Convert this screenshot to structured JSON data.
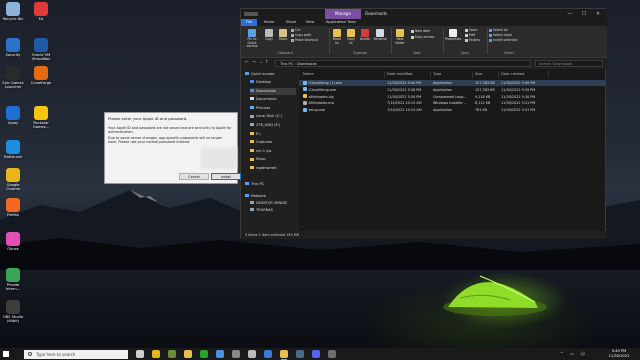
{
  "desktop": {
    "icons": [
      {
        "label": "Recycle Bin",
        "icon": "recycle-bin-icon",
        "color": "#8fb3d8"
      },
      {
        "label": "EA",
        "icon": "ea-icon",
        "color": "#e03a3a"
      },
      {
        "label": "Security",
        "icon": "shield-icon",
        "color": "#2a73c8"
      },
      {
        "label": "Oracle VM VirtualBox",
        "icon": "virtualbox-icon",
        "color": "#1e5aa8"
      },
      {
        "label": "Epic Games Launcher",
        "icon": "epic-games-icon",
        "color": "#2b2b2b"
      },
      {
        "label": "CurseForge",
        "icon": "curseforge-icon",
        "color": "#e4690f"
      },
      {
        "label": "Uplay",
        "icon": "uplay-icon",
        "color": "#1f6ed4"
      },
      {
        "label": "Rockstar Games...",
        "icon": "rockstar-icon",
        "color": "#f4c40f"
      },
      {
        "label": "Battle.net",
        "icon": "battlenet-icon",
        "color": "#1c8ee0"
      },
      {
        "label": "Google Chrome",
        "icon": "chrome-icon",
        "color": "#e9b61c"
      },
      {
        "label": "Firefox",
        "icon": "firefox-icon",
        "color": "#f26a21"
      },
      {
        "label": "iTunes",
        "icon": "itunes-icon",
        "color": "#e24fb4"
      },
      {
        "label": "Private Intern...",
        "icon": "vpn-icon",
        "color": "#3aa655"
      },
      {
        "label": "OBS Studio (64bit)",
        "icon": "obs-icon",
        "color": "#3d3d3d"
      }
    ]
  },
  "explorer": {
    "manage_tab": "Manage",
    "window_title": "Downloads",
    "window_controls": {
      "minimize": "—",
      "maximize": "☐",
      "close": "✕"
    },
    "tabs": [
      "File",
      "Home",
      "Share",
      "View",
      "Application Tools"
    ],
    "ribbon": {
      "pin": "Pin to Quick access",
      "copy": "Copy",
      "paste": "Paste",
      "cut": "Cut",
      "copy_path": "Copy path",
      "paste_shortcut": "Paste shortcut",
      "move_to": "Move to",
      "copy_to": "Copy to",
      "delete": "Delete",
      "rename": "Rename",
      "new_folder": "New folder",
      "new_item": "New item",
      "easy_access": "Easy access",
      "properties": "Properties",
      "open": "Open",
      "edit": "Edit",
      "history": "History",
      "select_all": "Select all",
      "select_none": "Select none",
      "invert_selection": "Invert selection",
      "groups": [
        "Clipboard",
        "Organize",
        "New",
        "Open",
        "Select"
      ]
    },
    "address": {
      "path": "This PC  ›  Downloads",
      "search_placeholder": "Search Downloads"
    },
    "nav": {
      "quick_access": "Quick access",
      "items": [
        {
          "label": "Desktop",
          "color": "#4a90e2"
        },
        {
          "label": "Downloads",
          "color": "#4a90e2"
        },
        {
          "label": "Documents",
          "color": "#cfd8e3"
        },
        {
          "label": "Pictures",
          "color": "#5fb0e8"
        },
        {
          "label": "Local Disk (C:)",
          "color": "#9aa6b2"
        },
        {
          "label": "2TB_HDD (E:)",
          "color": "#9aa6b2"
        },
        {
          "label": "E:\\",
          "color": "#e8c050"
        },
        {
          "label": "Captures",
          "color": "#e8c050"
        },
        {
          "label": "vm 1 ips",
          "color": "#e8c050"
        },
        {
          "label": "Music",
          "color": "#e8c050"
        },
        {
          "label": "rqpbnwired",
          "color": "#e8c050"
        }
      ],
      "this_pc": "This PC",
      "network": "Network",
      "network_items": [
        "DESKTOP-VRNDIE",
        "TRUENAS"
      ]
    },
    "columns": [
      "Name",
      "Date modified",
      "Type",
      "Size",
      "Date created"
    ],
    "files": [
      {
        "name": "iCloudSetup (1).exe",
        "modified": "11/30/2022 5:40 PM",
        "type": "Application",
        "size": "157,383 KB",
        "created": "11/30/2022 5:40 PM",
        "icon_color": "#7fb7f0",
        "selected": true
      },
      {
        "name": "iCloudSetup.exe",
        "modified": "11/30/2022 5:38 PM",
        "type": "Application",
        "size": "157,383 KB",
        "created": "11/30/2022 5:39 PM",
        "icon_color": "#7fb7f0",
        "selected": false
      },
      {
        "name": "alltrinkadm.zip",
        "modified": "11/30/2022 5:30 PM",
        "type": "Compressed (zipp...",
        "size": "9,118 KB",
        "created": "11/30/2022 5:30 PM",
        "icon_color": "#e8c050",
        "selected": false
      },
      {
        "name": "AMinstaller.msi",
        "modified": "7/14/2022 10:15 AM",
        "type": "Windows Installer ...",
        "size": "8,112 KB",
        "created": "11/30/2022 5:31 PM",
        "icon_color": "#b0b0b0",
        "selected": false
      },
      {
        "name": "setup.exe",
        "modified": "7/14/2022 10:14 AM",
        "type": "Application",
        "size": "781 KB",
        "created": "11/30/2022 5:31 PM",
        "icon_color": "#7fb7f0",
        "selected": false
      }
    ],
    "status": "5 items    1 item selected  153 MB"
  },
  "dialog": {
    "title": "Please enter your Apple ID and password.",
    "body": "Your Apple ID and password are not saved and are sent only to Apple for authentication.",
    "body2": "Due to some server changes, app-specific passwords will no longer work. Please use your normal password instead.",
    "cancel": "Cancel",
    "install": "Install"
  },
  "taskbar": {
    "search_placeholder": "Type here to search",
    "apps": [
      {
        "icon": "task-view-icon",
        "color": "#cfcfcf"
      },
      {
        "icon": "chrome-icon",
        "color": "#e9b61c"
      },
      {
        "icon": "minecraft-icon",
        "color": "#6b8e3a"
      },
      {
        "icon": "file-explorer-icon",
        "color": "#e8c050"
      },
      {
        "icon": "xbox-icon",
        "color": "#2aa52a"
      },
      {
        "icon": "store-icon",
        "color": "#4b8fe0"
      },
      {
        "icon": "obs-icon",
        "color": "#888888"
      },
      {
        "icon": "settings-icon",
        "color": "#bbbbbb"
      },
      {
        "icon": "photos-icon",
        "color": "#3a7ad8"
      },
      {
        "icon": "explorer-active-icon",
        "color": "#e8c050",
        "active": true
      },
      {
        "icon": "steam-icon",
        "color": "#4a6a8a"
      },
      {
        "icon": "discord-icon",
        "color": "#5865f2"
      },
      {
        "icon": "terminal-icon",
        "color": "#6e6e6e"
      }
    ],
    "time": "5:40 PM",
    "date": "11/30/2022"
  }
}
